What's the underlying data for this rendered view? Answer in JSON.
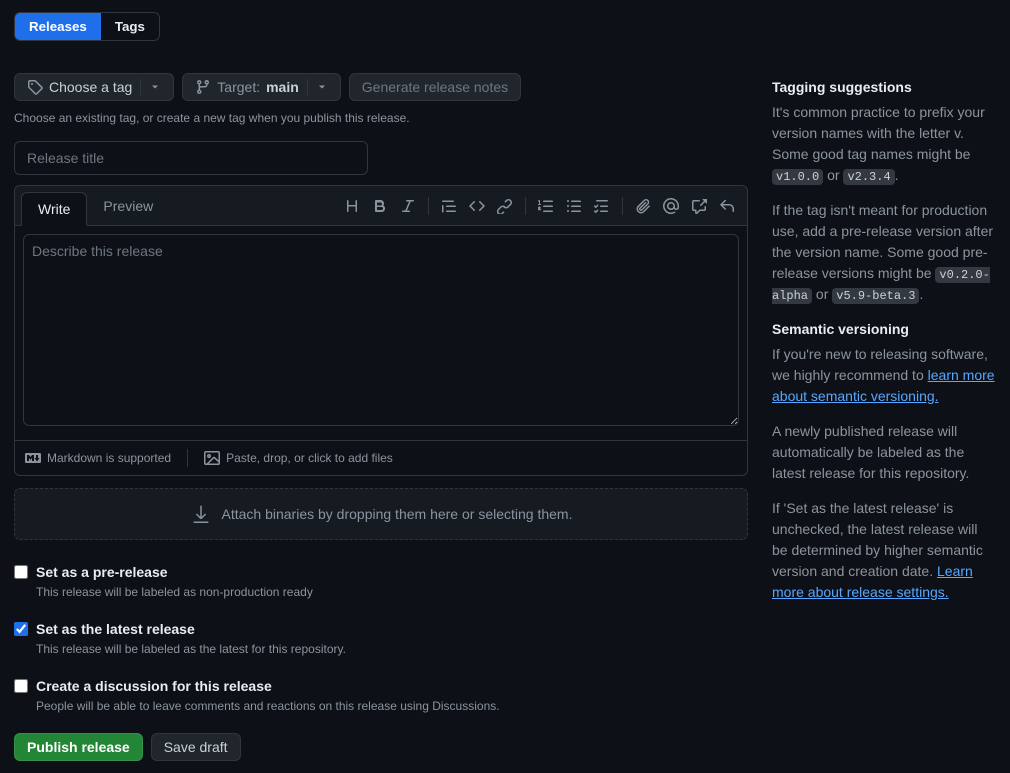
{
  "tabs": {
    "releases": "Releases",
    "tags": "Tags"
  },
  "tagBtn": {
    "label": "Choose a tag"
  },
  "targetBtn": {
    "prefix": "Target:",
    "value": "main"
  },
  "generateBtn": "Generate release notes",
  "tagHint": "Choose an existing tag, or create a new tag when you publish this release.",
  "titlePlaceholder": "Release title",
  "editor": {
    "writeTab": "Write",
    "previewTab": "Preview",
    "bodyPlaceholder": "Describe this release",
    "markdownHint": "Markdown is supported",
    "attachHint": "Paste, drop, or click to add files"
  },
  "dropzone": "Attach binaries by dropping them here or selecting them.",
  "options": {
    "prerelease": {
      "label": "Set as a pre-release",
      "desc": "This release will be labeled as non-production ready"
    },
    "latest": {
      "label": "Set as the latest release",
      "desc": "This release will be labeled as the latest for this repository."
    },
    "discussion": {
      "label": "Create a discussion for this release",
      "desc": "People will be able to leave comments and reactions on this release using Discussions."
    }
  },
  "actions": {
    "publish": "Publish release",
    "draft": "Save draft"
  },
  "sidebar": {
    "taggingHeading": "Tagging suggestions",
    "tagging_p1a": "It's common practice to prefix your version names with the letter v. Some good tag names might be ",
    "tagging_code1": "v1.0.0",
    "tagging_or": " or ",
    "tagging_code2": "v2.3.4",
    "tagging_period": ".",
    "tagging_p2a": "If the tag isn't meant for production use, add a pre-release version after the version name. Some good pre-release versions might be ",
    "tagging_code3": "v0.2.0-alpha",
    "tagging_code4": "v5.9-beta.3",
    "semverHeading": "Semantic versioning",
    "semver_p1a": "If you're new to releasing software, we highly recommend to ",
    "semver_link": "learn more about semantic versioning.",
    "latest_p": "A newly published release will automatically be labeled as the latest release for this repository.",
    "latest_unchecked_p": "If 'Set as the latest release' is unchecked, the latest release will be determined by higher semantic version and creation date. ",
    "latest_link": "Learn more about release settings."
  }
}
